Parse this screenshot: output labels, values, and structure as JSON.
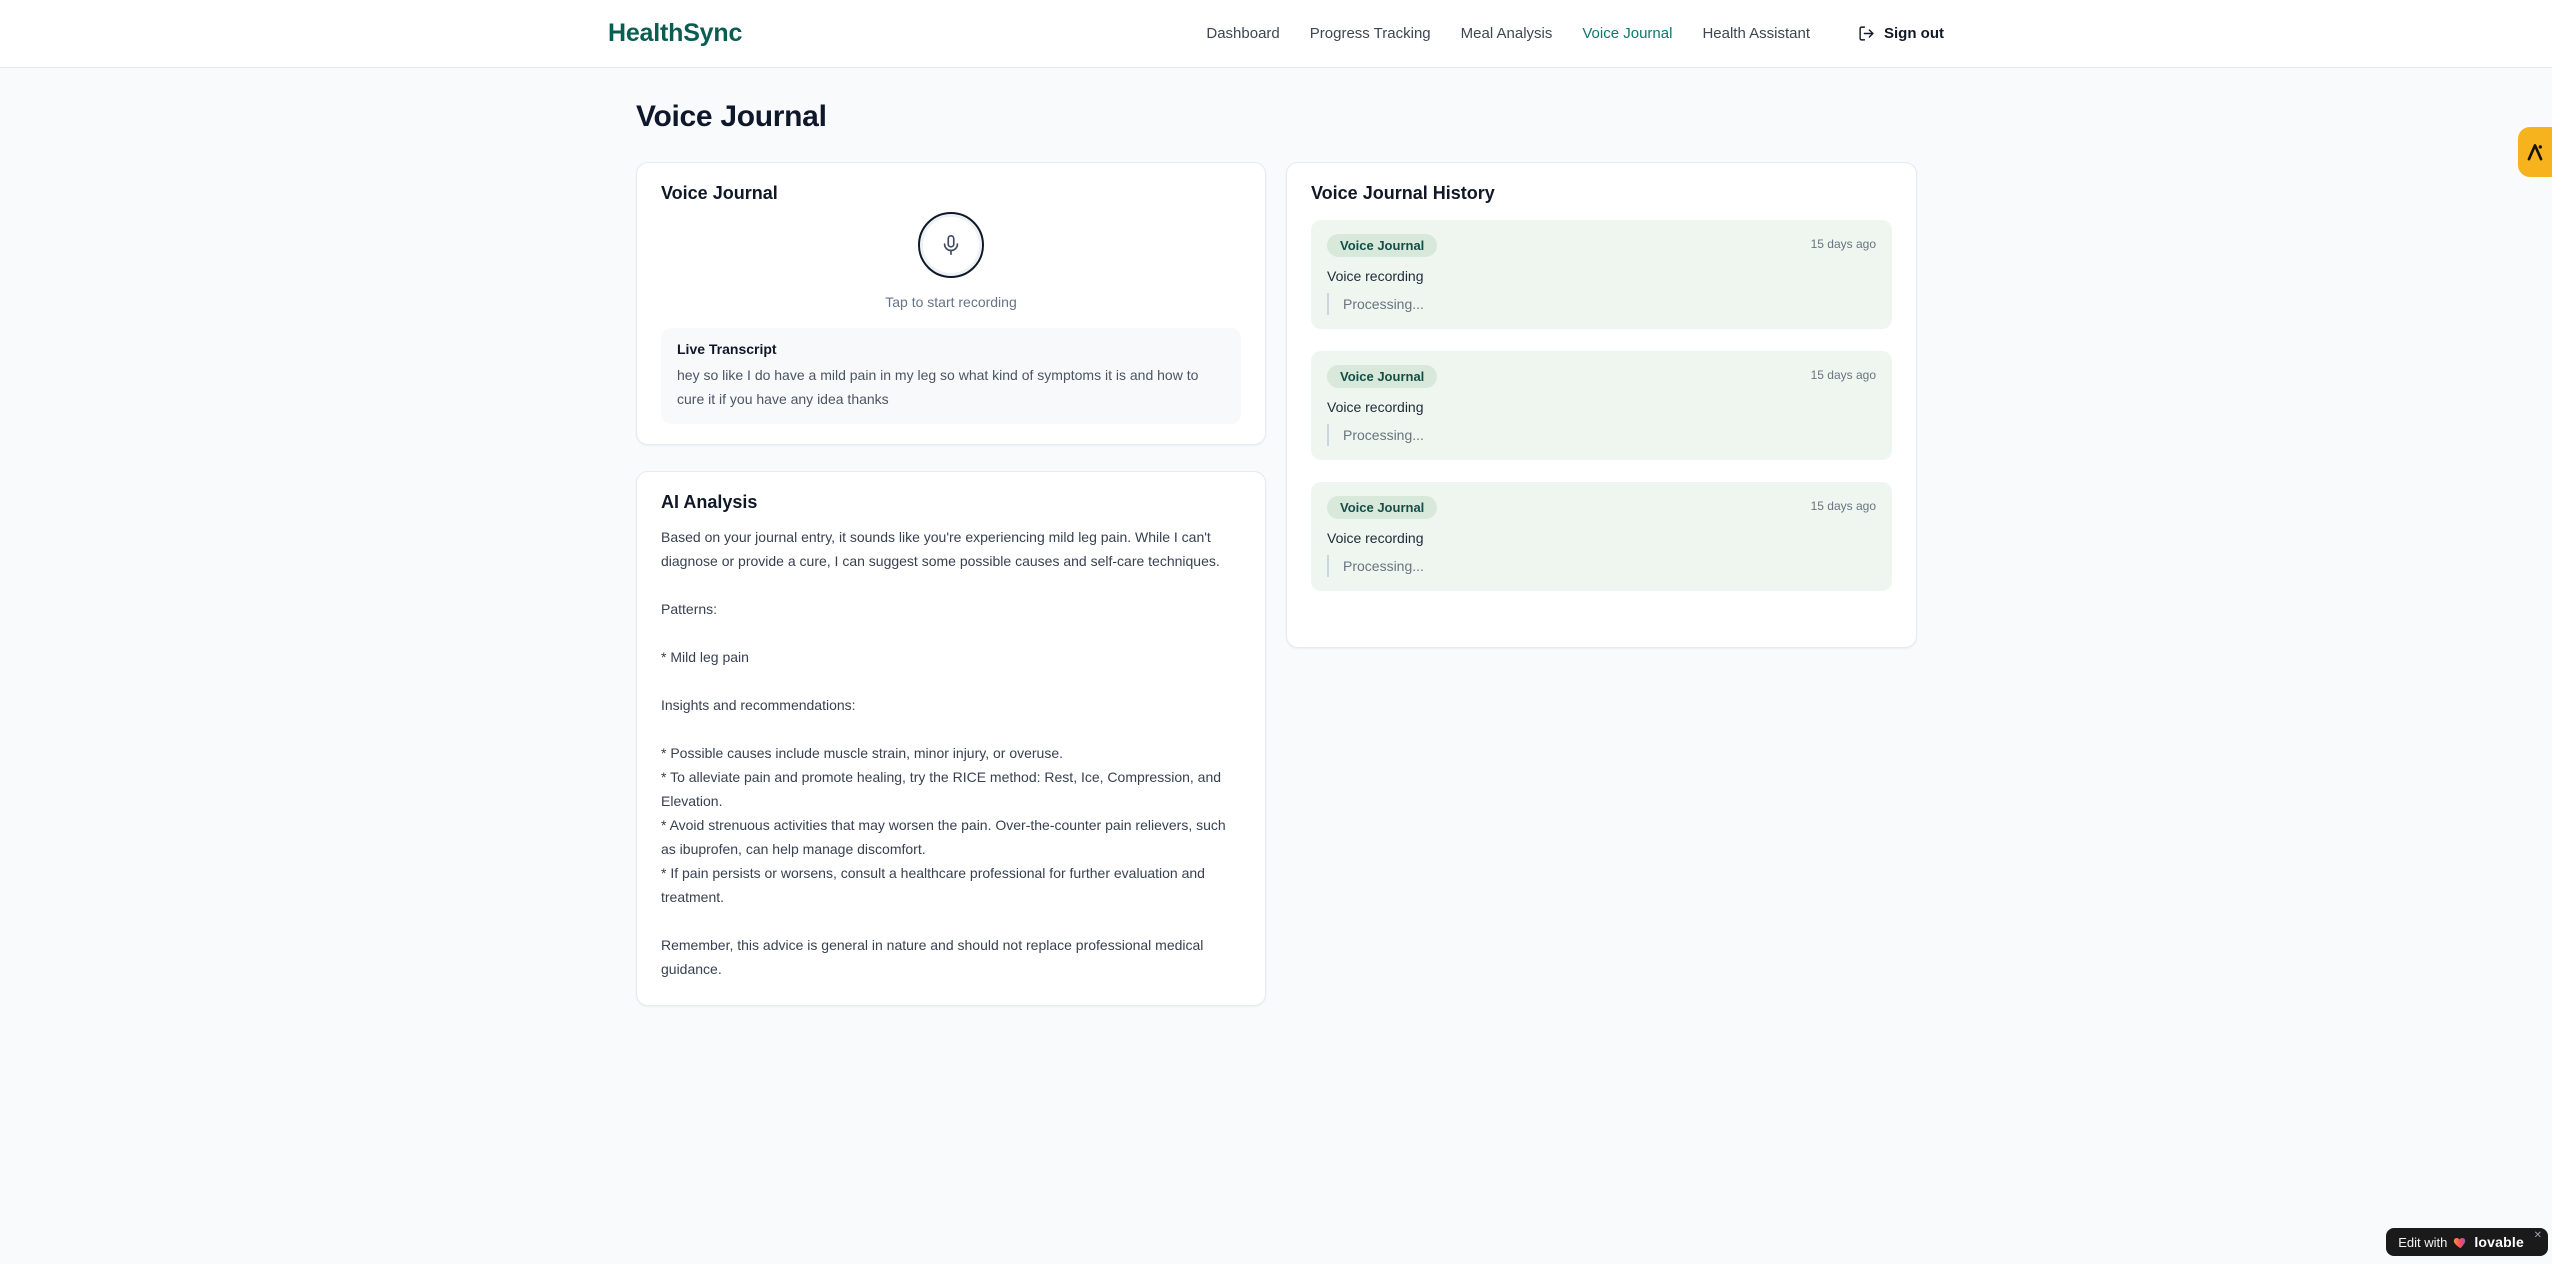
{
  "brand": "HealthSync",
  "nav": {
    "items": [
      {
        "label": "Dashboard"
      },
      {
        "label": "Progress Tracking"
      },
      {
        "label": "Meal Analysis"
      },
      {
        "label": "Voice Journal"
      },
      {
        "label": "Health Assistant"
      }
    ],
    "sign_out": "Sign out"
  },
  "page_title": "Voice Journal",
  "recorder": {
    "card_title": "Voice Journal",
    "tap_label": "Tap to start recording",
    "transcript_title": "Live Transcript",
    "transcript_text": "hey so like I do have a mild pain in my leg so what kind of symptoms it is and how to cure it if you have any idea thanks"
  },
  "analysis": {
    "card_title": "AI Analysis",
    "body": "Based on your journal entry, it sounds like you're experiencing mild leg pain. While I can't diagnose or provide a cure, I can suggest some possible causes and self-care techniques.\n\nPatterns:\n\n* Mild leg pain\n\nInsights and recommendations:\n\n* Possible causes include muscle strain, minor injury, or overuse.\n* To alleviate pain and promote healing, try the RICE method: Rest, Ice, Compression, and Elevation.\n* Avoid strenuous activities that may worsen the pain. Over-the-counter pain relievers, such as ibuprofen, can help manage discomfort.\n* If pain persists or worsens, consult a healthcare professional for further evaluation and treatment.\n\nRemember, this advice is general in nature and should not replace professional medical guidance."
  },
  "history": {
    "card_title": "Voice Journal History",
    "items": [
      {
        "badge": "Voice Journal",
        "time": "15 days ago",
        "description": "Voice recording",
        "status": "Processing..."
      },
      {
        "badge": "Voice Journal",
        "time": "15 days ago",
        "description": "Voice recording",
        "status": "Processing..."
      },
      {
        "badge": "Voice Journal",
        "time": "15 days ago",
        "description": "Voice recording",
        "status": "Processing..."
      }
    ]
  },
  "overlays": {
    "edit_badge": {
      "prefix": "Edit with",
      "brand": "lovable",
      "close": "✕"
    }
  },
  "colors": {
    "accent_teal": "#0f766e",
    "logo_teal": "#0b5d52",
    "history_item_bg": "#eef6ef",
    "badge_bg": "#d8e8da",
    "badge_text": "#134e48",
    "side_badge_amber": "#f6b31d",
    "edit_badge_bg": "#1a1a1a",
    "page_bg": "#f8fafc"
  }
}
